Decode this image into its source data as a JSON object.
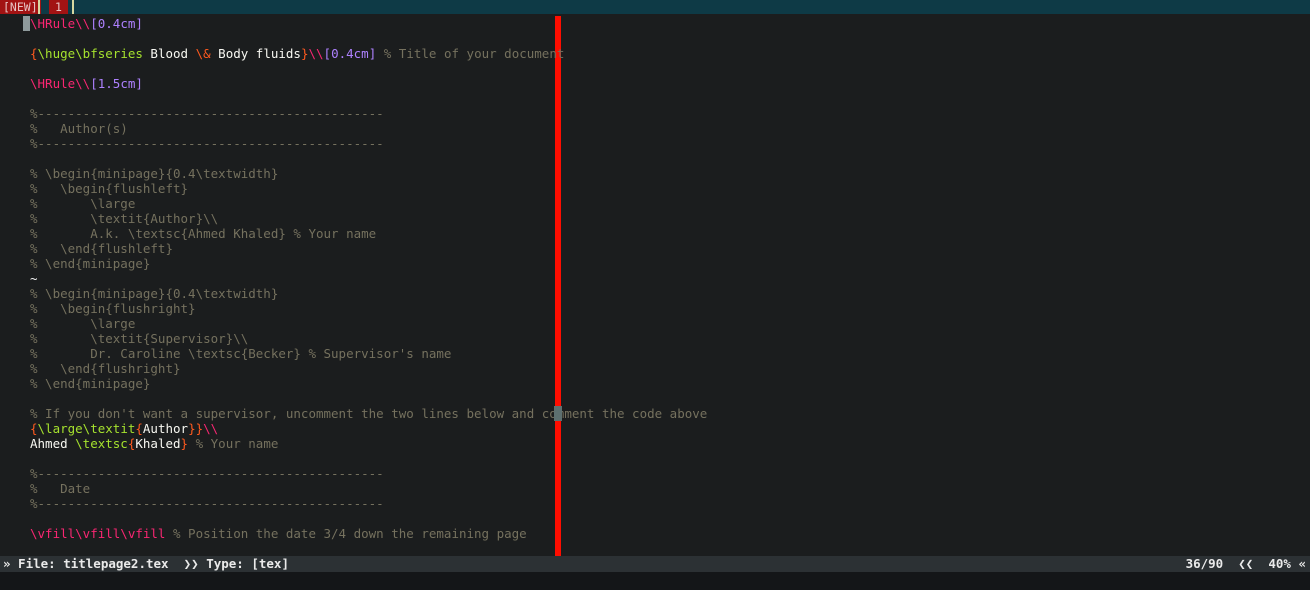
{
  "tabs": {
    "new_label": "[NEW]",
    "number_label": "1"
  },
  "code_lines": [
    [
      {
        "c": "cmd",
        "t": "\\HRule\\\\"
      },
      {
        "c": "num",
        "t": "[0.4cm]"
      }
    ],
    [],
    [
      {
        "c": "op",
        "t": "{"
      },
      {
        "c": "kw",
        "t": "\\huge\\bfseries"
      },
      {
        "c": "txt",
        "t": " Blood "
      },
      {
        "c": "op",
        "t": "\\&"
      },
      {
        "c": "txt",
        "t": " Body fluids"
      },
      {
        "c": "op",
        "t": "}"
      },
      {
        "c": "cmd",
        "t": "\\\\"
      },
      {
        "c": "num",
        "t": "[0.4cm]"
      },
      {
        "c": "com",
        "t": " % Title of your document"
      }
    ],
    [],
    [
      {
        "c": "cmd",
        "t": "\\HRule\\\\"
      },
      {
        "c": "num",
        "t": "[1.5cm]"
      }
    ],
    [],
    [
      {
        "c": "com",
        "t": "%----------------------------------------------"
      }
    ],
    [
      {
        "c": "com",
        "t": "%   Author(s)"
      }
    ],
    [
      {
        "c": "com",
        "t": "%----------------------------------------------"
      }
    ],
    [],
    [
      {
        "c": "com",
        "t": "% \\begin{minipage}{0.4\\textwidth}"
      }
    ],
    [
      {
        "c": "com",
        "t": "%   \\begin{flushleft}"
      }
    ],
    [
      {
        "c": "com",
        "t": "%       \\large"
      }
    ],
    [
      {
        "c": "com",
        "t": "%       \\textit{Author}\\\\"
      }
    ],
    [
      {
        "c": "com",
        "t": "%       A.k. \\textsc{Ahmed Khaled} % Your name"
      }
    ],
    [
      {
        "c": "com",
        "t": "%   \\end{flushleft}"
      }
    ],
    [
      {
        "c": "com",
        "t": "% \\end{minipage}"
      }
    ],
    [
      {
        "c": "tilde",
        "t": "~"
      }
    ],
    [
      {
        "c": "com",
        "t": "% \\begin{minipage}{0.4\\textwidth}"
      }
    ],
    [
      {
        "c": "com",
        "t": "%   \\begin{flushright}"
      }
    ],
    [
      {
        "c": "com",
        "t": "%       \\large"
      }
    ],
    [
      {
        "c": "com",
        "t": "%       \\textit{Supervisor}\\\\"
      }
    ],
    [
      {
        "c": "com",
        "t": "%       Dr. Caroline \\textsc{Becker} % Supervisor's name"
      }
    ],
    [
      {
        "c": "com",
        "t": "%   \\end{flushright}"
      }
    ],
    [
      {
        "c": "com",
        "t": "% \\end{minipage}"
      }
    ],
    [],
    [
      {
        "c": "com",
        "t": "% If you don't want a supervisor, uncomment the two lines below and comment the code above"
      }
    ],
    [
      {
        "c": "op",
        "t": "{"
      },
      {
        "c": "kw",
        "t": "\\large\\textit"
      },
      {
        "c": "op",
        "t": "{"
      },
      {
        "c": "txt",
        "t": "Author"
      },
      {
        "c": "op",
        "t": "}}"
      },
      {
        "c": "cmd",
        "t": "\\\\"
      }
    ],
    [
      {
        "c": "txt",
        "t": "Ahmed "
      },
      {
        "c": "kw",
        "t": "\\textsc"
      },
      {
        "c": "op",
        "t": "{"
      },
      {
        "c": "txt",
        "t": "Khaled"
      },
      {
        "c": "op",
        "t": "}"
      },
      {
        "c": "com",
        "t": " % Your name"
      }
    ],
    [],
    [
      {
        "c": "com",
        "t": "%----------------------------------------------"
      }
    ],
    [
      {
        "c": "com",
        "t": "%   Date"
      }
    ],
    [
      {
        "c": "com",
        "t": "%----------------------------------------------"
      }
    ],
    [],
    [
      {
        "c": "cmd",
        "t": "\\vfill\\vfill\\vfill"
      },
      {
        "c": "com",
        "t": " % Position the date 3/4 down the remaining page"
      }
    ]
  ],
  "status": {
    "file_label": "» File: titlepage2.tex",
    "type_label": "  ❯❯ Type: [tex]",
    "position": "36/90",
    "percent_label": "  ❮❮  40% «"
  }
}
